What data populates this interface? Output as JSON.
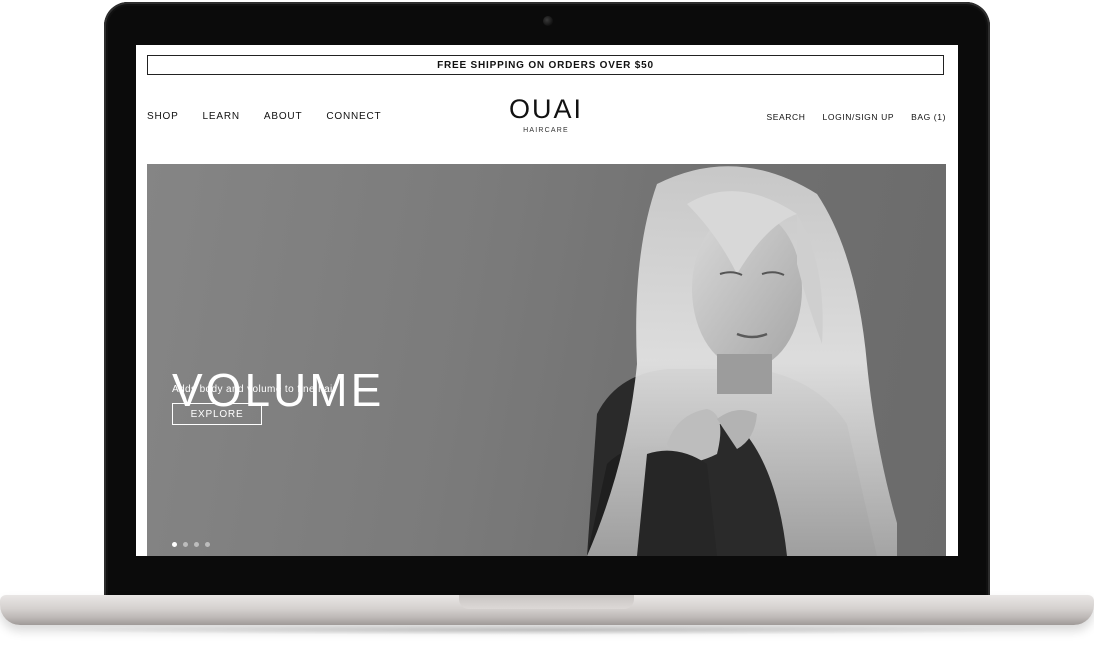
{
  "promo": {
    "text": "FREE SHIPPING ON ORDERS OVER $50"
  },
  "nav": {
    "left": [
      {
        "label": "SHOP"
      },
      {
        "label": "LEARN"
      },
      {
        "label": "ABOUT"
      },
      {
        "label": "CONNECT"
      }
    ],
    "right": [
      {
        "label": "SEARCH"
      },
      {
        "label": "LOGIN/SIGN UP"
      },
      {
        "label": "BAG (1)"
      }
    ]
  },
  "logo": {
    "main": "OUAI",
    "sub": "HAIRCARE"
  },
  "hero": {
    "title": "VOLUME",
    "subtitle": "Adds body and volume to fine hair",
    "button_label": "EXPLORE",
    "slide_count": 4,
    "active_slide": 1
  }
}
